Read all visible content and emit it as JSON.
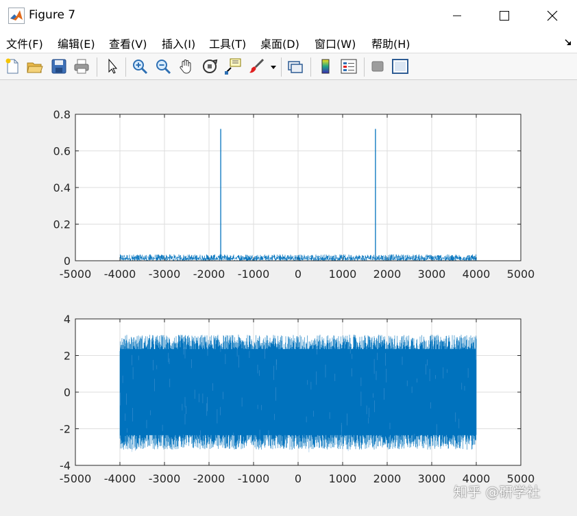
{
  "window": {
    "title": "Figure 7",
    "minimize_icon": "minimize-icon",
    "maximize_icon": "maximize-icon",
    "close_icon": "close-icon"
  },
  "menu": {
    "items": [
      "文件(F)",
      "编辑(E)",
      "查看(V)",
      "插入(I)",
      "工具(T)",
      "桌面(D)",
      "窗口(W)",
      "帮助(H)"
    ]
  },
  "toolbar": {
    "buttons": [
      "new-figure-icon",
      "open-file-icon",
      "save-icon",
      "print-icon",
      "pointer-icon",
      "zoom-in-icon",
      "zoom-out-icon",
      "pan-hand-icon",
      "rotate-3d-icon",
      "data-cursor-icon",
      "brush-icon",
      "brush-dropdown-icon",
      "link-plot-icon",
      "colorbar-icon",
      "legend-icon",
      "hide-plot-tools-icon",
      "show-plot-tools-icon"
    ]
  },
  "colors": {
    "line": "#0072bd",
    "grid": "#dedede",
    "axis": "#262626"
  },
  "chart_data": [
    {
      "type": "line",
      "title": "",
      "xlabel": "",
      "ylabel": "",
      "xlim": [
        -5000,
        5000
      ],
      "ylim": [
        0,
        0.8
      ],
      "grid": true,
      "xticks": [
        "-5000",
        "-4000",
        "-3000",
        "-2000",
        "-1000",
        "0",
        "1000",
        "2000",
        "3000",
        "4000",
        "5000"
      ],
      "yticks": [
        "0",
        "0.2",
        "0.4",
        "0.6",
        "0.8"
      ],
      "series": [
        {
          "description_of_values": "noise floor between -4000 and 4000 with two spectral peaks",
          "x": [
            -4000,
            -1740,
            -1737,
            -1734,
            1734,
            1737,
            1740,
            4000
          ],
          "y": [
            0.02,
            0.02,
            0.72,
            0.02,
            0.02,
            0.72,
            0.02,
            0.02
          ],
          "noise_range": [
            0,
            0.035
          ]
        }
      ]
    },
    {
      "type": "line",
      "title": "",
      "xlabel": "",
      "ylabel": "",
      "xlim": [
        -5000,
        5000
      ],
      "ylim": [
        -4,
        4
      ],
      "grid": true,
      "xticks": [
        "-5000",
        "-4000",
        "-3000",
        "-2000",
        "-1000",
        "0",
        "1000",
        "2000",
        "3000",
        "4000",
        "5000"
      ],
      "yticks": [
        "-4",
        "-2",
        "0",
        "2",
        "4"
      ],
      "series": [
        {
          "x_range": [
            -4000,
            4000
          ],
          "y_range": [
            -3.14,
            3.14
          ]
        }
      ]
    }
  ],
  "watermark": "知乎 @研学社"
}
